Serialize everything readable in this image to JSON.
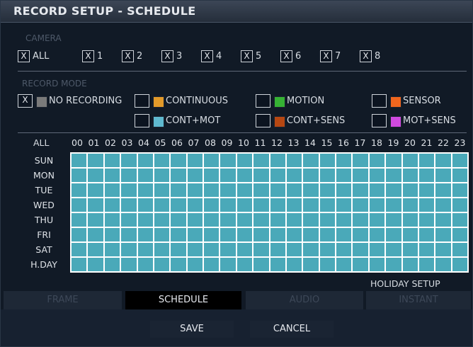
{
  "window": {
    "title": "RECORD SETUP - SCHEDULE"
  },
  "camera": {
    "label": "CAMERA",
    "items": [
      {
        "check": "X",
        "label": "ALL"
      },
      {
        "check": "X",
        "label": "1"
      },
      {
        "check": "X",
        "label": "2"
      },
      {
        "check": "X",
        "label": "3"
      },
      {
        "check": "X",
        "label": "4"
      },
      {
        "check": "X",
        "label": "5"
      },
      {
        "check": "X",
        "label": "6"
      },
      {
        "check": "X",
        "label": "7"
      },
      {
        "check": "X",
        "label": "8"
      }
    ]
  },
  "record_mode": {
    "label": "RECORD MODE",
    "modes": [
      {
        "check": "X",
        "label": "NO RECORDING",
        "color": "#7a7a7a"
      },
      {
        "check": "",
        "label": "CONTINUOUS",
        "color": "#e29a2a"
      },
      {
        "check": "",
        "label": "MOTION",
        "color": "#36b234"
      },
      {
        "check": "",
        "label": "SENSOR",
        "color": "#f0661e"
      },
      {
        "check": "",
        "label": "CONT+MOT",
        "color": "#5fb9cf"
      },
      {
        "check": "",
        "label": "CONT+SENS",
        "color": "#b64712"
      },
      {
        "check": "",
        "label": "MOT+SENS",
        "color": "#d04adf"
      }
    ]
  },
  "schedule": {
    "all_label": "ALL",
    "hours": [
      "00",
      "01",
      "02",
      "03",
      "04",
      "05",
      "06",
      "07",
      "08",
      "09",
      "10",
      "11",
      "12",
      "13",
      "14",
      "15",
      "16",
      "17",
      "18",
      "19",
      "20",
      "21",
      "22",
      "23"
    ],
    "days": [
      "SUN",
      "MON",
      "TUE",
      "WED",
      "THU",
      "FRI",
      "SAT",
      "H.DAY"
    ],
    "cell_color": "#4aa9b9"
  },
  "holiday_setup": "HOLIDAY SETUP",
  "tabs": [
    {
      "label": "FRAME",
      "active": false
    },
    {
      "label": "SCHEDULE",
      "active": true
    },
    {
      "label": "AUDIO",
      "active": false
    },
    {
      "label": "INSTANT",
      "active": false
    }
  ],
  "buttons": {
    "save": "SAVE",
    "cancel": "CANCEL"
  }
}
